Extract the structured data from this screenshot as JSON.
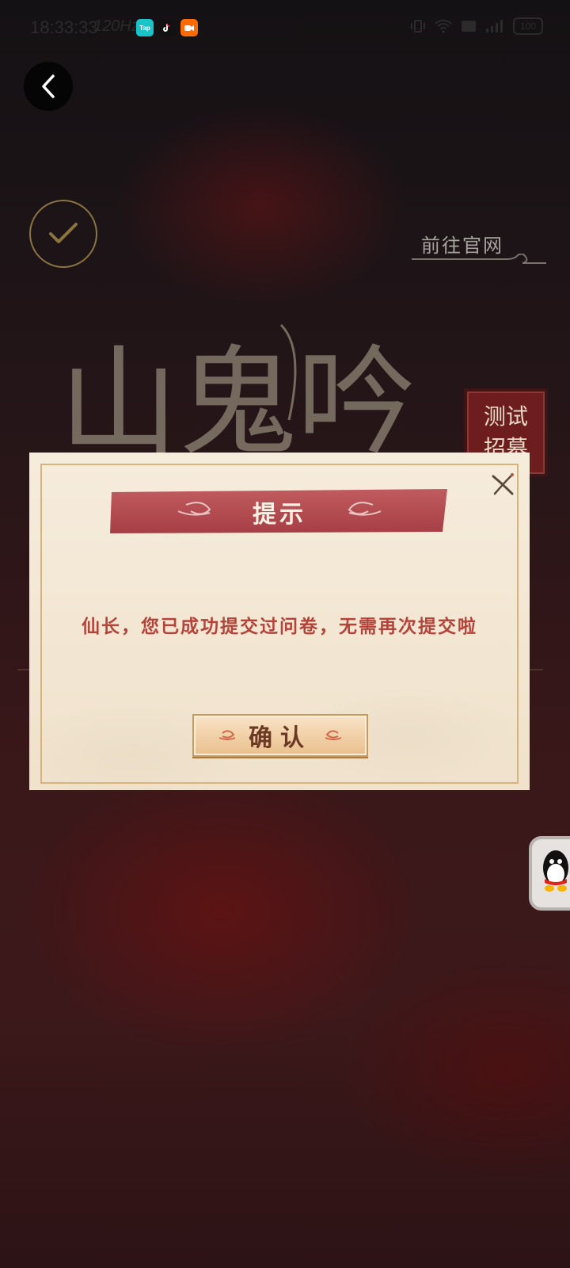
{
  "status_bar": {
    "time": "18:33:33",
    "refresh_rate": "120Hz",
    "apps": [
      "Tap",
      "抖音",
      "快手"
    ],
    "battery": "100"
  },
  "header": {
    "website_link": "前往官网"
  },
  "logo": {
    "text": "山鬼吟",
    "badge_line1": "测试",
    "badge_line2": "招募"
  },
  "dialog": {
    "title": "提示",
    "message": "仙长，您已成功提交过问卷，无需再次提交啦",
    "confirm_label": "确认"
  },
  "colors": {
    "accent_red": "#b4433a",
    "banner_red": "#b3494f",
    "gold": "#8a7441",
    "parchment": "#f4e8d5"
  },
  "icons": [
    "back-icon",
    "check-icon",
    "close-icon",
    "qq-icon"
  ]
}
